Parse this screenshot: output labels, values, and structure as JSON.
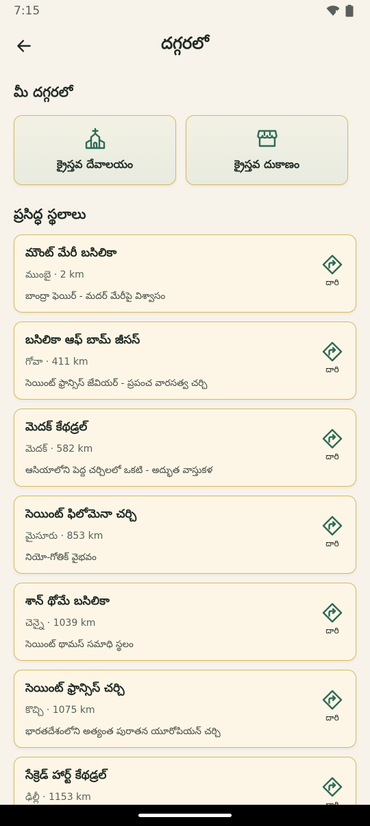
{
  "status_bar": {
    "time": "7:15"
  },
  "header": {
    "title": "దగ్గరలో"
  },
  "nearby": {
    "section_title": "మీ దగ్గరలో",
    "buttons": [
      {
        "label": "క్రైస్తవ దేవాలయం",
        "icon": "church-icon"
      },
      {
        "label": "క్రైస్తవ దుకాణం",
        "icon": "store-icon"
      }
    ]
  },
  "famous": {
    "section_title": "ప్రసిద్ధ స్థలాలు",
    "directions_label": "దారి",
    "places": [
      {
        "name": "మౌంట్ మేరీ బసిలికా",
        "meta": "ముంబై · 2 km",
        "desc": "బాంద్రా ఫెయిర్ - మదర్ మేరీపై విశ్వాసం"
      },
      {
        "name": "బసిలికా ఆఫ్ బామ్ జీసస్",
        "meta": "గోవా · 411 km",
        "desc": "సెయింట్ ఫ్రాన్సిస్ జేవియర్ - ప్రపంచ వారసత్వ చర్చి"
      },
      {
        "name": "మెదక్ కేథడ్రల్",
        "meta": "మెదక్ · 582 km",
        "desc": "ఆసియాలోని పెద్ద చర్చిలలో ఒకటి - అద్భుత వాస్తుకళ"
      },
      {
        "name": "సెయింట్ ఫిలోమెనా చర్చి",
        "meta": "మైసూరు · 853 km",
        "desc": "నియో-గోతిక్ వైభవం"
      },
      {
        "name": "శాన్ థోమే బసిలికా",
        "meta": "చెన్నై · 1039 km",
        "desc": "సెయింట్ థామస్ సమాధి స్థలం"
      },
      {
        "name": "సెయింట్ ఫ్రాన్సిస్ చర్చి",
        "meta": "కొచ్చి · 1075 km",
        "desc": "భారతదేశంలోని అత్యంత పురాతన యూరోపియన్ చర్చి"
      },
      {
        "name": "సేక్రెడ్ హార్ట్ కేథడ్రల్",
        "meta": "ఢిల్లీ · 1153 km",
        "desc": ""
      }
    ]
  }
}
